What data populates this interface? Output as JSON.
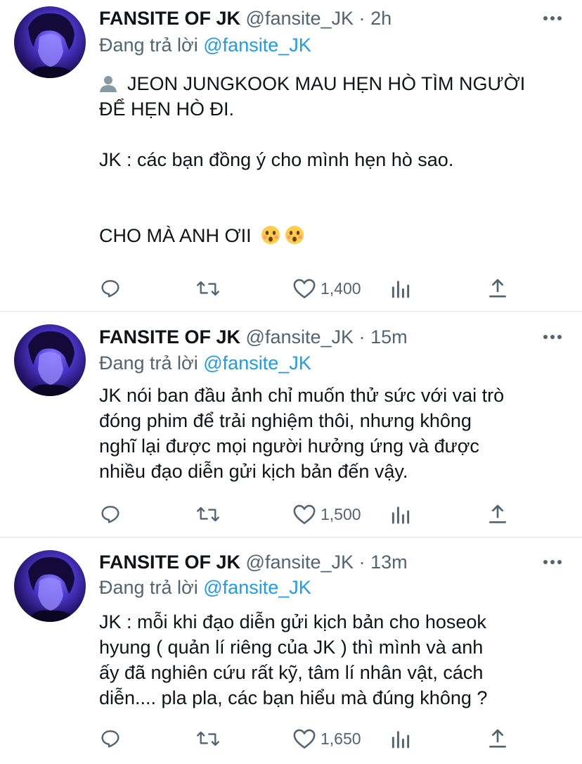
{
  "tweets": [
    {
      "name": "FANSITE OF JK",
      "handle": "@fansite_JK",
      "dot": "·",
      "time": "2h",
      "reply_prefix": "Đang trả lời ",
      "reply_mention": "@fansite_JK",
      "lines": [
        "JEON JUNGKOOK MAU HẸN HÒ TÌM NGƯỜI",
        "ĐỂ HẸN HÒ ĐI.",
        "JK : các bạn đồng ý cho mình hẹn hò sao.",
        "CHO MÀ ANH ƠII"
      ],
      "likes": "1,400"
    },
    {
      "name": "FANSITE OF JK",
      "handle": "@fansite_JK",
      "dot": "·",
      "time": "15m",
      "reply_prefix": "Đang trả lời ",
      "reply_mention": "@fansite_JK",
      "lines": [
        "JK nói ban đầu ảnh chỉ muốn thử sức với vai trò",
        "đóng phim để trải nghiệm thôi, nhưng không",
        "nghĩ lại được mọi người hưởng ứng và được",
        "nhiều đạo diễn gửi kịch bản đến vậy."
      ],
      "likes": "1,500"
    },
    {
      "name": "FANSITE OF JK",
      "handle": "@fansite_JK",
      "dot": "·",
      "time": "13m",
      "reply_prefix": "Đang trả lời ",
      "reply_mention": "@fansite_JK",
      "lines": [
        "JK : mỗi khi đạo diễn gửi kịch bản cho hoseok",
        "hyung ( quản lí riêng của JK ) thì mình và anh",
        "ấy đã nghiên cứu rất kỹ, tâm lí nhân vật, cách",
        "diễn.... pla pla, các bạn hiểu mà đúng không ?"
      ],
      "likes": "1,650"
    }
  ],
  "colors": {
    "text": "#0f1419",
    "secondary": "#536471",
    "link": "#1d9bf0",
    "divider": "#e1e6ea"
  },
  "icons": [
    "user-icon",
    "astonished-face-emoji",
    "reply-icon",
    "retweet-icon",
    "like-icon",
    "analytics-icon",
    "share-icon",
    "more-icon"
  ]
}
